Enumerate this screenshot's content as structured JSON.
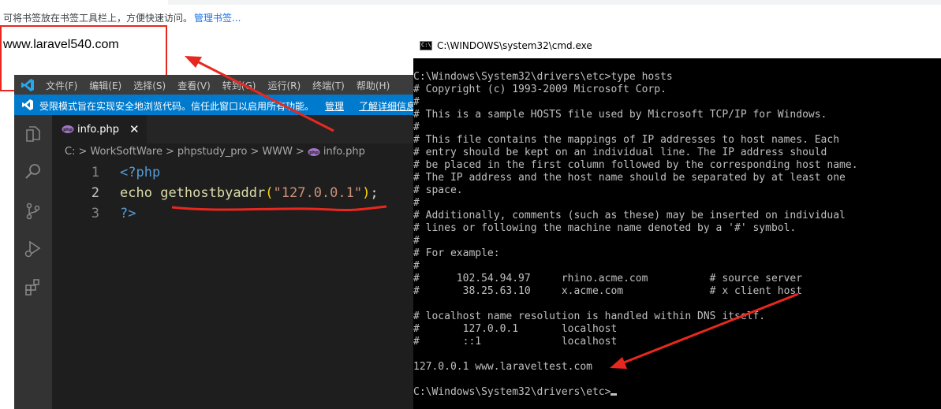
{
  "browser": {
    "bookmark_tip": "可将书签放在书签工具栏上，方便快速访问。",
    "bookmark_manage": "管理书签...",
    "page_output": "www.laravel540.com"
  },
  "vscode": {
    "menu": [
      "文件(F)",
      "编辑(E)",
      "选择(S)",
      "查看(V)",
      "转到(G)",
      "运行(R)",
      "终端(T)",
      "帮助(H)"
    ],
    "banner_text": "受限模式旨在实现安全地浏览代码。信任此窗口以启用所有功能。",
    "banner_manage": "管理",
    "banner_more": "了解详细信息",
    "tab_label": "info.php",
    "tab_close": "✕",
    "breadcrumb": [
      "C:",
      "WorkSoftWare",
      "phpstudy_pro",
      "WWW",
      "info.php"
    ],
    "breadcrumb_sep": ">",
    "lines": [
      {
        "num": "1",
        "text": "<?php"
      },
      {
        "num": "2",
        "echo": "echo",
        "func": "gethostbyaddr",
        "open": "(",
        "str": "\"127.0.0.1\"",
        "close": ")",
        "semi": ";"
      },
      {
        "num": "3",
        "text": "?>"
      }
    ]
  },
  "cmd": {
    "title": "C:\\WINDOWS\\system32\\cmd.exe",
    "icon_label": "C:\\",
    "lines": [
      "",
      "C:\\Windows\\System32\\drivers\\etc>type hosts",
      "# Copyright (c) 1993-2009 Microsoft Corp.",
      "#",
      "# This is a sample HOSTS file used by Microsoft TCP/IP for Windows.",
      "#",
      "# This file contains the mappings of IP addresses to host names. Each",
      "# entry should be kept on an individual line. The IP address should",
      "# be placed in the first column followed by the corresponding host name.",
      "# The IP address and the host name should be separated by at least one",
      "# space.",
      "#",
      "# Additionally, comments (such as these) may be inserted on individual",
      "# lines or following the machine name denoted by a '#' symbol.",
      "#",
      "# For example:",
      "#",
      "#      102.54.94.97     rhino.acme.com          # source server",
      "#       38.25.63.10     x.acme.com              # x client host",
      "",
      "# localhost name resolution is handled within DNS itself.",
      "#       127.0.0.1       localhost",
      "#       ::1             localhost",
      "",
      "127.0.0.1 www.laraveltest.com",
      "",
      "C:\\Windows\\System32\\drivers\\etc>"
    ]
  },
  "annotation_color": "#e8281f"
}
